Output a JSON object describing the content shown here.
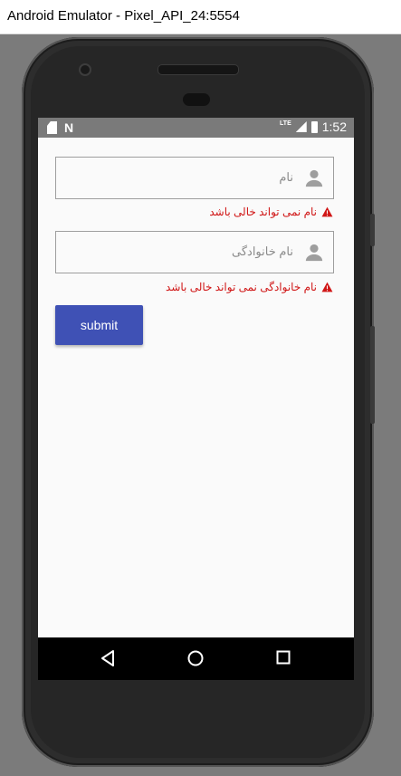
{
  "window": {
    "title": "Android Emulator - Pixel_API_24:5554"
  },
  "status_bar": {
    "time": "1:52",
    "network": "LTE"
  },
  "form": {
    "first_name": {
      "placeholder": "نام",
      "icon": "person-icon"
    },
    "first_name_error": "نام نمی تواند خالی باشد",
    "last_name": {
      "placeholder": "نام خانوادگی",
      "icon": "person-icon"
    },
    "last_name_error": "نام خانوادگی نمی تواند خالی باشد",
    "submit_label": "submit"
  },
  "colors": {
    "accent": "#3f51b5",
    "error": "#d01616",
    "status_bar": "#7a7a7a"
  },
  "nav_bar": {
    "buttons": [
      "back-icon",
      "home-icon",
      "recents-icon"
    ]
  }
}
